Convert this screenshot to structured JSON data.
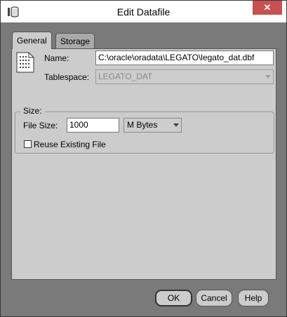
{
  "window": {
    "title": "Edit Datafile",
    "close_glyph": "✕"
  },
  "tabs": [
    {
      "label": "General",
      "selected": true
    },
    {
      "label": "Storage",
      "selected": false
    }
  ],
  "general": {
    "name_label": "Name:",
    "name_value": "C:\\oracle\\oradata\\LEGATO\\legato_dat.dbf",
    "tablespace_label": "Tablespace:",
    "tablespace_value": "LEGATO_DAT",
    "size_group_title": "Size:",
    "file_size_label": "File Size:",
    "file_size_value": "1000",
    "unit_value": "M Bytes",
    "reuse_label": "Reuse Existing File",
    "reuse_checked": false
  },
  "buttons": {
    "ok": "OK",
    "cancel": "Cancel",
    "help": "Help"
  },
  "icons": {
    "app": "database-cylinder-icon",
    "file": "datafile-icon",
    "close": "close-icon",
    "dropdown": "chevron-down-icon"
  }
}
